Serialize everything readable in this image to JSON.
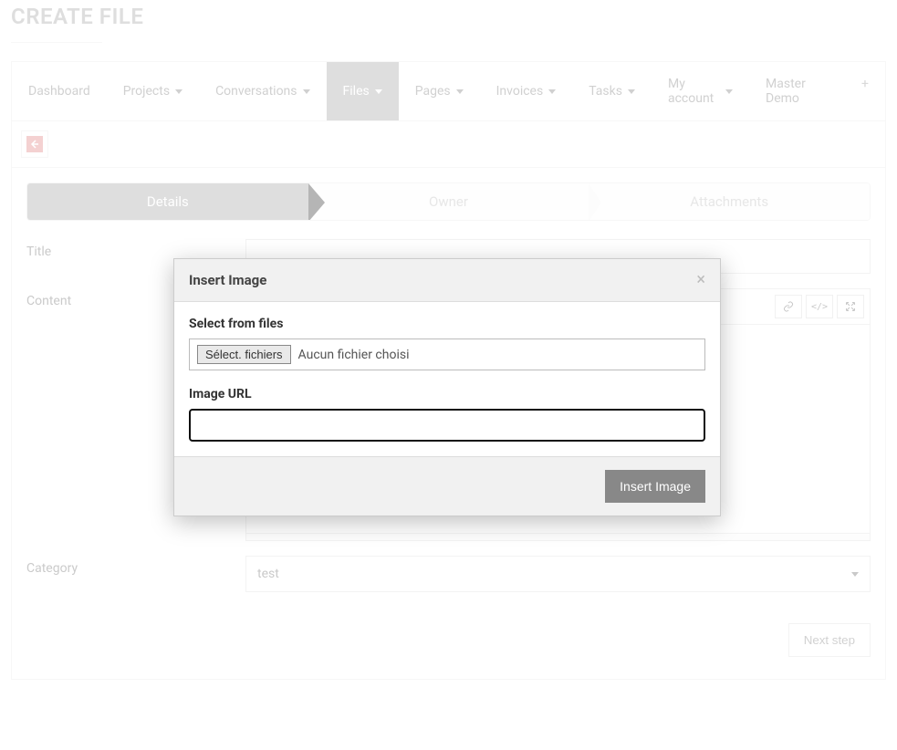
{
  "header": {
    "title": "CREATE FILE"
  },
  "nav": {
    "items": [
      {
        "label": "Dashboard",
        "dropdown": false,
        "active": false
      },
      {
        "label": "Projects",
        "dropdown": true,
        "active": false
      },
      {
        "label": "Conversations",
        "dropdown": true,
        "active": false
      },
      {
        "label": "Files",
        "dropdown": true,
        "active": true
      },
      {
        "label": "Pages",
        "dropdown": true,
        "active": false
      },
      {
        "label": "Invoices",
        "dropdown": true,
        "active": false
      },
      {
        "label": "Tasks",
        "dropdown": true,
        "active": false
      },
      {
        "label": "My account",
        "dropdown": true,
        "active": false
      },
      {
        "label": "Master Demo",
        "dropdown": false,
        "active": false
      }
    ],
    "plus": "+"
  },
  "steps": [
    {
      "label": "Details",
      "active": true
    },
    {
      "label": "Owner",
      "active": false
    },
    {
      "label": "Attachments",
      "active": false
    }
  ],
  "form": {
    "title_label": "Title",
    "title_value": "",
    "content_label": "Content",
    "category_label": "Category",
    "category_value": "test",
    "next_btn": "Next step"
  },
  "toolbar": {
    "icons": [
      "link-icon",
      "code-icon",
      "fullscreen-icon"
    ]
  },
  "modal": {
    "title": "Insert Image",
    "select_label": "Select from files",
    "file_button": "Sélect. fichiers",
    "file_status": "Aucun fichier choisi",
    "url_label": "Image URL",
    "url_value": "",
    "insert_btn": "Insert Image",
    "close": "×"
  }
}
